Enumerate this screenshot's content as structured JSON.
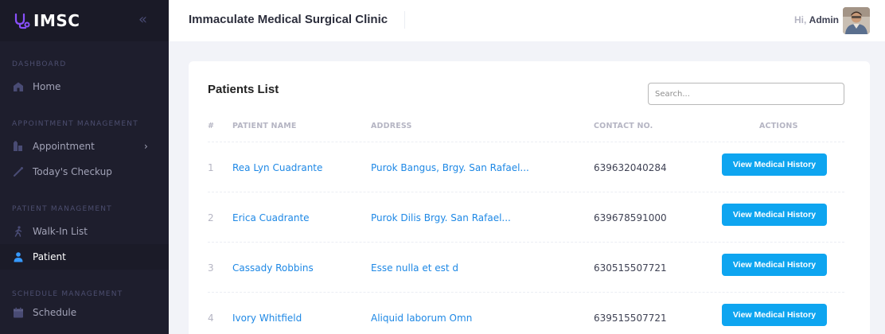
{
  "brand": {
    "name": "IMSC",
    "collapse_icon": "«"
  },
  "sidebar": {
    "sections": [
      {
        "label": "Dashboard"
      },
      {
        "label": "Appointment Management"
      },
      {
        "label": "Patient Management"
      },
      {
        "label": "Schedule Management"
      }
    ],
    "items": [
      {
        "label": "Home",
        "icon": "home-icon"
      },
      {
        "label": "Appointment",
        "icon": "appointment-icon",
        "chevron": "›"
      },
      {
        "label": "Today's Checkup",
        "icon": "checkup-icon"
      },
      {
        "label": "Walk-In List",
        "icon": "walking-person-icon"
      },
      {
        "label": "Patient",
        "icon": "person-icon",
        "active": true
      },
      {
        "label": "Schedule",
        "icon": "calendar-icon"
      }
    ]
  },
  "header": {
    "title": "Immaculate Medical Surgical Clinic",
    "greeting_hi": "Hi,",
    "greeting_name": "Admin"
  },
  "patients": {
    "title": "Patients List",
    "search_placeholder": "Search...",
    "columns": [
      "#",
      "Patient Name",
      "Address",
      "Contact No.",
      "Actions"
    ],
    "action_label": "View Medical History",
    "rows": [
      {
        "num": "1",
        "name": "Rea Lyn Cuadrante",
        "address": "Purok Bangus, Brgy. San Rafael...",
        "contact": "639632040284"
      },
      {
        "num": "2",
        "name": "Erica Cuadrante",
        "address": "Purok Dilis Brgy. San Rafael...",
        "contact": "639678591000"
      },
      {
        "num": "3",
        "name": "Cassady Robbins",
        "address": "Esse nulla et est d",
        "contact": "630515507721"
      },
      {
        "num": "4",
        "name": "Ivory Whitfield",
        "address": "Aliquid laborum Omn",
        "contact": "639515507721"
      }
    ]
  },
  "colors": {
    "sidebar_bg": "#1e1e2d",
    "accent": "#1e88e5",
    "button": "#0ea5f0",
    "active_icon": "#3699ff"
  }
}
